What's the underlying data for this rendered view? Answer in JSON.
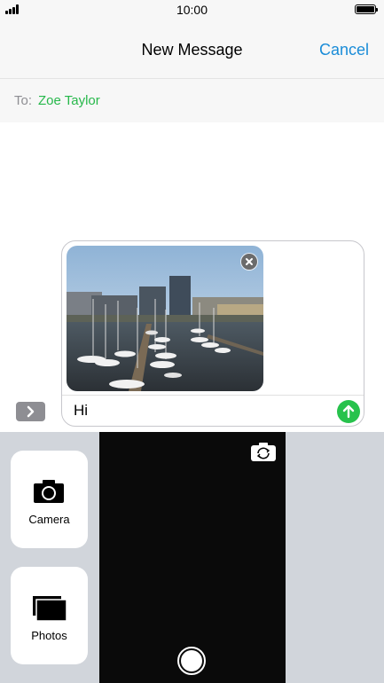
{
  "status_bar": {
    "time": "10:00",
    "signal_icon": "signal-bars-icon",
    "battery_icon": "battery-icon"
  },
  "nav": {
    "title": "New Message",
    "cancel_label": "Cancel",
    "accent_color": "#1a8cd8"
  },
  "recipient": {
    "label": "To:",
    "name": "Zoe Taylor",
    "name_color": "#27b84b"
  },
  "compose": {
    "attachment_description": "photo attachment: harbour with sailing boats and modern buildings",
    "message_text": "Hi",
    "send_icon": "send-arrow-icon",
    "send_color": "#27c24c"
  },
  "tray": {
    "camera_label": "Camera",
    "photos_label": "Photos",
    "switch_camera_icon": "switch-camera-icon",
    "shutter_icon": "shutter-icon"
  }
}
